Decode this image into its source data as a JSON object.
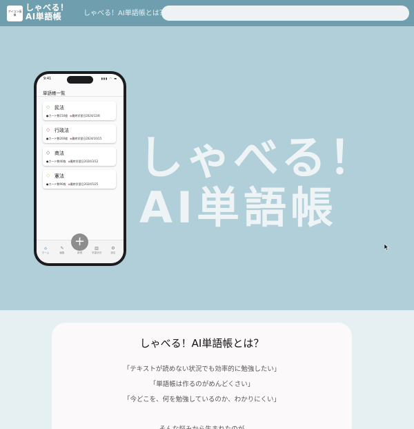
{
  "header": {
    "logo_icon_text": "アイコン画像",
    "logo_line1": "しゃべる！",
    "logo_line2": "AI単語帳",
    "nav_link": "しゃべる！AI単語帳とは？",
    "search_value": ""
  },
  "hero": {
    "line1": "しゃべる！",
    "line2": "AI単語帳"
  },
  "phone": {
    "time": "9:41",
    "status_icons": "▮▮▮ ◠ ▬",
    "screen_title": "単語帳一覧",
    "cards": [
      {
        "title": "民法",
        "card_count": "カード数150枚",
        "last_study": "最終学習日2024/12/8",
        "tag_color": "#7bbf6a"
      },
      {
        "title": "行政法",
        "card_count": "カード数200枚",
        "last_study": "最終学習日2024/10/15",
        "tag_color": "#d9534f"
      },
      {
        "title": "商法",
        "card_count": "カード数40枚",
        "last_study": "最終学習日2024/3/12",
        "tag_color": "#555555"
      },
      {
        "title": "憲法",
        "card_count": "カード数90枚",
        "last_study": "最終学習日2024/5/25",
        "tag_color": "#e3c14a"
      }
    ],
    "tabs": [
      {
        "label": "ホーム",
        "icon": "home-icon"
      },
      {
        "label": "編集",
        "icon": "pencil-icon"
      },
      {
        "label": "学習状況",
        "icon": "chart-icon"
      },
      {
        "label": "設定",
        "icon": "gear-icon"
      }
    ],
    "fab_label": "新規"
  },
  "about": {
    "title": "しゃべる！AI単語帳とは？",
    "quote1": "「テキストが読めない状況でも効率的に勉強したい」",
    "quote2": "「単語帳は作るのがめんどくさい」",
    "quote3": "「今どこを、何を勉強しているのか、わかりにくい」",
    "quote4": "そんな悩みから生まれたのが"
  }
}
